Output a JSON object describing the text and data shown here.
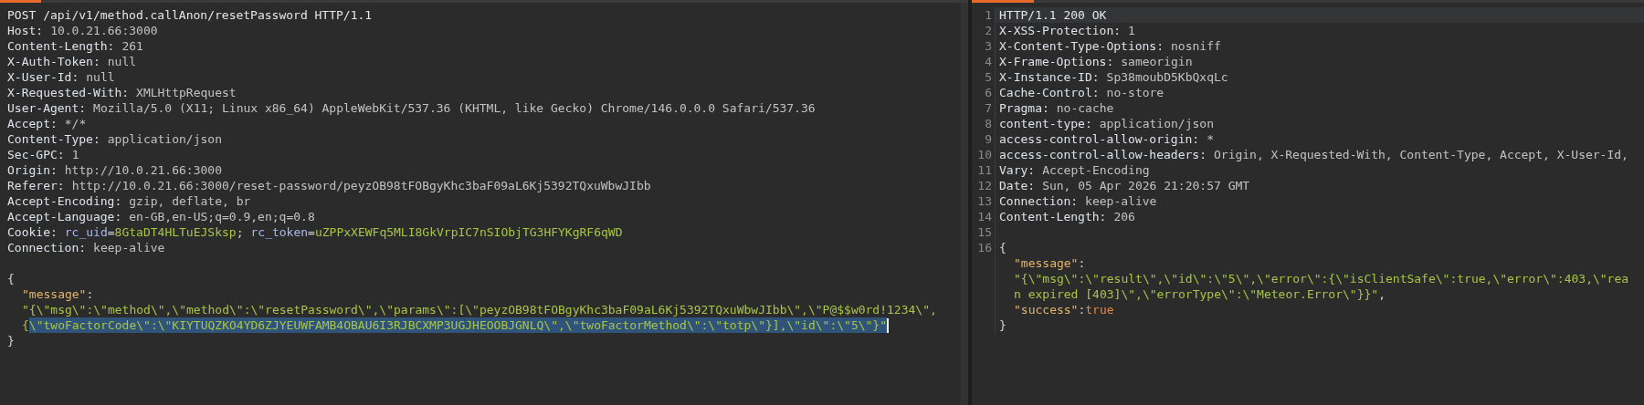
{
  "request": {
    "request_line": "POST /api/v1/method.callAnon/resetPassword HTTP/1.1",
    "headers": [
      {
        "name": "Host:",
        "value": "10.0.21.66:3000"
      },
      {
        "name": "Content-Length:",
        "value": "261"
      },
      {
        "name": "X-Auth-Token:",
        "value": "null"
      },
      {
        "name": "X-User-Id:",
        "value": "null"
      },
      {
        "name": "X-Requested-With:",
        "value": "XMLHttpRequest"
      },
      {
        "name": "User-Agent:",
        "value": "Mozilla/5.0 (X11; Linux x86_64) AppleWebKit/537.36 (KHTML, like Gecko) Chrome/146.0.0.0 Safari/537.36"
      },
      {
        "name": "Accept:",
        "value": "*/*"
      },
      {
        "name": "Content-Type:",
        "value": "application/json"
      },
      {
        "name": "Sec-GPC:",
        "value": "1"
      },
      {
        "name": "Origin:",
        "value": "http://10.0.21.66:3000"
      },
      {
        "name": "Referer:",
        "value": "http://10.0.21.66:3000/reset-password/peyzOB98tFOBgyKhc3baF09aL6Kj5392TQxuWbwJIbb"
      },
      {
        "name": "Accept-Encoding:",
        "value": "gzip, deflate, br"
      },
      {
        "name": "Accept-Language:",
        "value": "en-GB,en-US;q=0.9,en;q=0.8"
      },
      {
        "name": "Cookie:",
        "segments": [
          {
            "text": "rc_uid",
            "kind": "cookie_name"
          },
          {
            "text": "=",
            "kind": "punct"
          },
          {
            "text": "8GtaDT4HLTuEJSksp",
            "kind": "cookie_value"
          },
          {
            "text": ";",
            "kind": "punct"
          },
          {
            "text": "rc_token",
            "kind": "cookie_name"
          },
          {
            "text": "=",
            "kind": "punct"
          },
          {
            "text": "uZPPxXEWFq5MLI8GkVrpIC7nSIObjTG3HFYKgRF6qWD",
            "kind": "cookie_value"
          }
        ]
      },
      {
        "name": "Connection:",
        "value": "keep-alive"
      }
    ],
    "body": [
      {
        "indent": false,
        "segments": [
          {
            "text": "{",
            "kind": "punct",
            "selected": false
          }
        ]
      },
      {
        "indent": true,
        "segments": [
          {
            "text": "\"message\"",
            "kind": "key",
            "selected": false
          },
          {
            "text": ":",
            "kind": "punct",
            "selected": false
          }
        ]
      },
      {
        "indent": true,
        "segments": [
          {
            "text": "\"{\\\"msg\\\":\\\"method\\\",\\\"method\\\":\\\"resetPassword\\\",\\\"params\\\":[\\\"peyzOB98tFOBgyKhc3baF09aL6Kj5392TQxuWbwJIbb\\\",\\\"P@$$w0rd!1234\\\",",
            "kind": "string",
            "selected": false
          }
        ]
      },
      {
        "indent": true,
        "segments": [
          {
            "text": "{",
            "kind": "string",
            "selected": false
          },
          {
            "text": "\\\"twoFactorCode\\\":\\\"KIYTUQZKO4YD6ZJYEUWFAMB4OBAU6I3RJBCXMP3UGJHEOOBJGNLQ\\\",\\\"twoFactorMethod\\\":\\\"totp\\\"}],\\\"id\\\":\\\"5\\\"}\"",
            "kind": "string",
            "selected": true
          }
        ],
        "cursor": true
      },
      {
        "indent": false,
        "segments": [
          {
            "text": "}",
            "kind": "punct",
            "selected": false
          }
        ]
      }
    ]
  },
  "response": {
    "lines": [
      {
        "number": "1",
        "kind": "status",
        "text": "HTTP/1.1 200 OK",
        "highlighted": true
      },
      {
        "number": "2",
        "kind": "header",
        "name": "X-XSS-Protection:",
        "value": "1",
        "highlighted": false
      },
      {
        "number": "3",
        "kind": "header",
        "name": "X-Content-Type-Options:",
        "value": "nosniff",
        "highlighted": false
      },
      {
        "number": "4",
        "kind": "header",
        "name": "X-Frame-Options:",
        "value": "sameorigin",
        "highlighted": false
      },
      {
        "number": "5",
        "kind": "header",
        "name": "X-Instance-ID:",
        "value": "Sp38moubD5KbQxqLc",
        "highlighted": false
      },
      {
        "number": "6",
        "kind": "header",
        "name": "Cache-Control:",
        "value": "no-store",
        "highlighted": false
      },
      {
        "number": "7",
        "kind": "header",
        "name": "Pragma:",
        "value": "no-cache",
        "highlighted": false
      },
      {
        "number": "8",
        "kind": "header",
        "name": "content-type:",
        "value": "application/json",
        "highlighted": false
      },
      {
        "number": "9",
        "kind": "header",
        "name": "access-control-allow-origin:",
        "value": "*",
        "highlighted": false
      },
      {
        "number": "10",
        "kind": "header",
        "name": "access-control-allow-headers:",
        "value": "Origin, X-Requested-With, Content-Type, Accept, X-User-Id,",
        "highlighted": false
      },
      {
        "number": "11",
        "kind": "header",
        "name": "Vary:",
        "value": "Accept-Encoding",
        "highlighted": false
      },
      {
        "number": "12",
        "kind": "header",
        "name": "Date:",
        "value": "Sun, 05 Apr 2026 21:20:57 GMT",
        "highlighted": false
      },
      {
        "number": "13",
        "kind": "header",
        "name": "Connection:",
        "value": "keep-alive",
        "highlighted": false
      },
      {
        "number": "14",
        "kind": "header",
        "name": "Content-Length:",
        "value": "206",
        "highlighted": false
      },
      {
        "number": "15",
        "kind": "blank",
        "highlighted": false
      },
      {
        "number": "16",
        "kind": "body",
        "indent": false,
        "segments": [
          {
            "text": "{",
            "kind": "punct"
          }
        ],
        "highlighted": false
      },
      {
        "kind": "body",
        "indent": true,
        "segments": [
          {
            "text": "\"message\"",
            "kind": "key"
          },
          {
            "text": ":",
            "kind": "punct"
          }
        ],
        "highlighted": false
      },
      {
        "kind": "body",
        "indent": true,
        "segments": [
          {
            "text": "\"{\\\"msg\\\":\\\"result\\\",\\\"id\\\":\\\"5\\\",\\\"error\\\":{\\\"isClientSafe\\\":true,\\\"error\\\":403,\\\"rea",
            "kind": "string"
          }
        ],
        "highlighted": false
      },
      {
        "kind": "body",
        "indent": true,
        "segments": [
          {
            "text": "n expired [403]\\\",\\\"errorType\\\":\\\"Meteor.Error\\\"}}\"",
            "kind": "string"
          },
          {
            "text": ",",
            "kind": "punct"
          }
        ],
        "highlighted": false
      },
      {
        "kind": "body",
        "indent": true,
        "segments": [
          {
            "text": "\"success\"",
            "kind": "key"
          },
          {
            "text": ":",
            "kind": "punct"
          },
          {
            "text": "true",
            "kind": "bool"
          }
        ],
        "highlighted": false
      },
      {
        "kind": "body",
        "indent": false,
        "segments": [
          {
            "text": "}",
            "kind": "punct"
          }
        ],
        "highlighted": false
      }
    ]
  }
}
